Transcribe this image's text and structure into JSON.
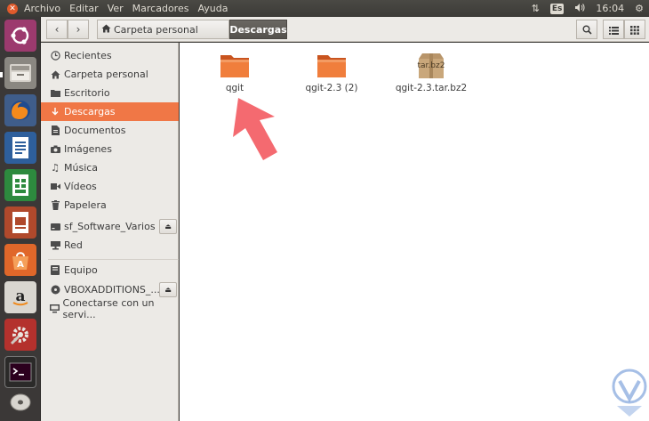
{
  "window": {
    "menu": [
      "Archivo",
      "Editar",
      "Ver",
      "Marcadores",
      "Ayuda"
    ],
    "indicators": {
      "keyboard": "Es",
      "clock": "16:04"
    }
  },
  "launcher": {
    "apps": [
      "ubuntu-dash",
      "files",
      "firefox",
      "writer",
      "calc",
      "impress",
      "software-center",
      "amazon",
      "system-settings",
      "terminal",
      "disc"
    ]
  },
  "toolbar": {
    "breadcrumb_home": "Carpeta personal",
    "breadcrumb_current": "Descargas"
  },
  "sidebar": {
    "items": [
      {
        "label": "Recientes",
        "icon": "clock-icon"
      },
      {
        "label": "Carpeta personal",
        "icon": "home-icon"
      },
      {
        "label": "Escritorio",
        "icon": "folder-icon"
      },
      {
        "label": "Descargas",
        "icon": "download-icon",
        "active": true
      },
      {
        "label": "Documentos",
        "icon": "document-icon"
      },
      {
        "label": "Imágenes",
        "icon": "camera-icon"
      },
      {
        "label": "Música",
        "icon": "music-icon"
      },
      {
        "label": "Vídeos",
        "icon": "video-icon"
      },
      {
        "label": "Papelera",
        "icon": "trash-icon"
      },
      {
        "label": "sf_Software_Varios",
        "icon": "drive-icon",
        "eject": true
      },
      {
        "label": "Red",
        "icon": "network-icon"
      }
    ],
    "devices": [
      {
        "label": "Equipo",
        "icon": "computer-icon"
      },
      {
        "label": "VBOXADDITIONS_...",
        "icon": "disc-icon",
        "eject": true
      },
      {
        "label": "Conectarse con un servi...",
        "icon": "server-icon"
      }
    ]
  },
  "files": [
    {
      "name": "qgit",
      "type": "folder"
    },
    {
      "name": "qgit-2.3 (2)",
      "type": "folder"
    },
    {
      "name": "qgit-2.3.tar.bz2",
      "type": "archive",
      "badge": "tar.bz2"
    }
  ],
  "colors": {
    "accent": "#f07746",
    "arrow": "#f46a70",
    "folder": "#f07e3c",
    "panel": "#3c3b37"
  }
}
